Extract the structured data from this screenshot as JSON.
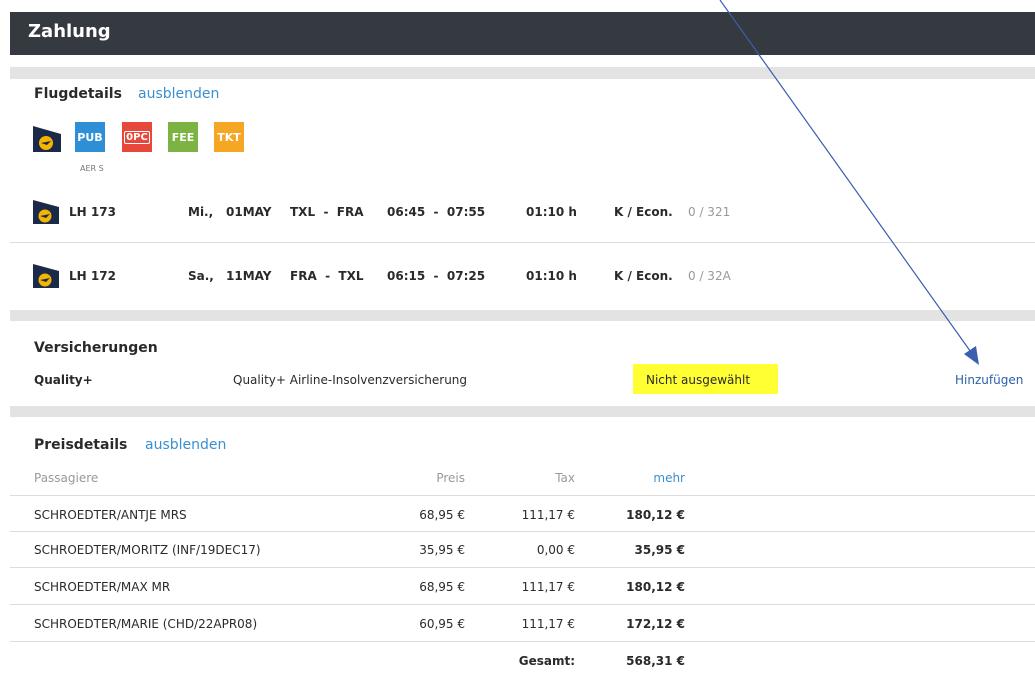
{
  "header": {
    "title": "Zahlung"
  },
  "flight_details": {
    "title": "Flugdetails",
    "toggle_label": "ausblenden",
    "badges": [
      {
        "label": "PUB",
        "color": "#2e8fd7"
      },
      {
        "label": "0PC",
        "color": "#e8483b"
      },
      {
        "label": "FEE",
        "color": "#7cb342"
      },
      {
        "label": "TKT",
        "color": "#f5a623"
      }
    ],
    "badge_caption": "AER S",
    "flights": [
      {
        "flight": "LH 173",
        "day": "Mi.,",
        "date": "01MAY",
        "route": "TXL  -  FRA",
        "time": "06:45  -  07:55",
        "duration": "01:10 h",
        "class": "K / Econ.",
        "aircraft": "0 / 321"
      },
      {
        "flight": "LH 172",
        "day": "Sa.,",
        "date": "11MAY",
        "route": "FRA  -  TXL",
        "time": "06:15  -  07:25",
        "duration": "01:10 h",
        "class": "K / Econ.",
        "aircraft": "0 / 32A"
      }
    ]
  },
  "insurance": {
    "title": "Versicherungen",
    "name": "Quality+",
    "description": "Quality+ Airline-Insolvenzversicherung",
    "status": "Nicht ausgewählt",
    "action": "Hinzufügen"
  },
  "price_details": {
    "title": "Preisdetails",
    "toggle_label": "ausblenden",
    "columns": {
      "passengers": "Passagiere",
      "price": "Preis",
      "tax": "Tax",
      "more": "mehr"
    },
    "rows": [
      {
        "name": "SCHROEDTER/ANTJE MRS",
        "price": "68,95 €",
        "tax": "111,17 €",
        "total": "180,12 €"
      },
      {
        "name": "SCHROEDTER/MORITZ (INF/19DEC17)",
        "price": "35,95 €",
        "tax": "0,00 €",
        "total": "35,95 €"
      },
      {
        "name": "SCHROEDTER/MAX MR",
        "price": "68,95 €",
        "tax": "111,17 €",
        "total": "180,12 €"
      },
      {
        "name": "SCHROEDTER/MARIE (CHD/22APR08)",
        "price": "60,95 €",
        "tax": "111,17 €",
        "total": "172,12 €"
      }
    ],
    "total_label": "Gesamt:",
    "total_value": "568,31 €"
  },
  "colors": {
    "header_bg": "#343a40",
    "link": "#3a8fd0",
    "highlight": "#ffff33",
    "arrow": "#3b5fae"
  }
}
